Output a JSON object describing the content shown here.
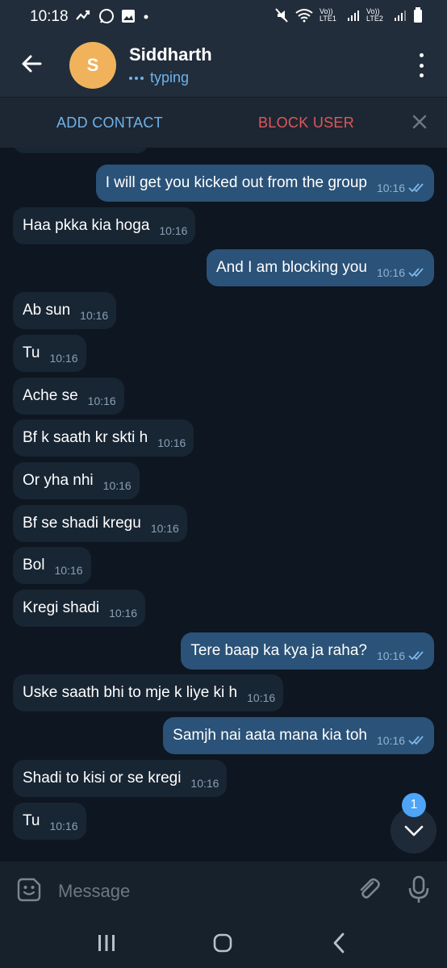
{
  "status_bar": {
    "time": "10:18",
    "sim1": "Vo)) LTE1",
    "sim2": "Vo)) LTE2"
  },
  "header": {
    "avatar_letter": "S",
    "contact_name": "Siddharth",
    "status": "typing"
  },
  "actions": {
    "add_contact": "ADD CONTACT",
    "block_user": "BLOCK USER"
  },
  "messages": [
    {
      "dir": "out",
      "text": "I will get you kicked out from the group",
      "time": "10:16"
    },
    {
      "dir": "in",
      "text": "Haa pkka kia hoga",
      "time": "10:16"
    },
    {
      "dir": "out",
      "text": "And I am blocking you",
      "time": "10:16"
    },
    {
      "dir": "in",
      "text": "Ab sun",
      "time": "10:16"
    },
    {
      "dir": "in",
      "text": "Tu",
      "time": "10:16"
    },
    {
      "dir": "in",
      "text": "Ache se",
      "time": "10:16"
    },
    {
      "dir": "in",
      "text": "Bf k saath kr skti h",
      "time": "10:16"
    },
    {
      "dir": "in",
      "text": "Or yha nhi",
      "time": "10:16"
    },
    {
      "dir": "in",
      "text": "Bf se shadi kregu",
      "time": "10:16"
    },
    {
      "dir": "in",
      "text": "Bol",
      "time": "10:16"
    },
    {
      "dir": "in",
      "text": "Kregi shadi",
      "time": "10:16"
    },
    {
      "dir": "out",
      "text": "Tere baap ka kya ja raha?",
      "time": "10:16"
    },
    {
      "dir": "in",
      "text": "Uske saath bhi to mje k liye ki h",
      "time": "10:16"
    },
    {
      "dir": "out",
      "text": "Samjh nai aata mana kia toh",
      "time": "10:16"
    },
    {
      "dir": "in",
      "text": "Shadi to kisi or se kregi",
      "time": "10:16"
    },
    {
      "dir": "in",
      "text": "Tu",
      "time": "10:16"
    }
  ],
  "scroll_down": {
    "unread_count": "1"
  },
  "composer": {
    "placeholder": "Message"
  },
  "colors": {
    "background": "#0e1621",
    "header": "#212d3b",
    "incoming_bubble": "#182533",
    "outgoing_bubble": "#2b5278",
    "accent_blue": "#6fb3ea",
    "danger_red": "#e0575a",
    "avatar": "#f0b35b"
  }
}
